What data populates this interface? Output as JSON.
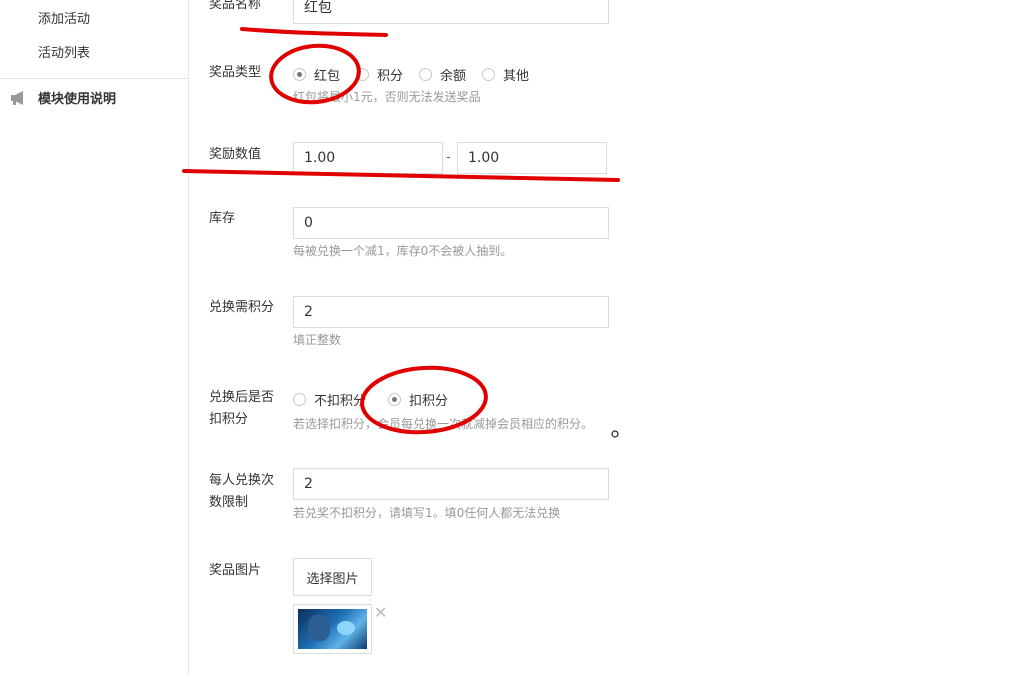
{
  "sidebar": {
    "items": [
      {
        "label": "添加活动"
      },
      {
        "label": "活动列表"
      }
    ],
    "section": {
      "label": "模块使用说明",
      "icon": "megaphone-icon"
    }
  },
  "form": {
    "prize_name": {
      "label": "奖品名称",
      "value": "红包"
    },
    "prize_type": {
      "label": "奖品类型",
      "options": [
        "红包",
        "积分",
        "余额",
        "其他"
      ],
      "selected": "红包",
      "help": "红包将最小1元，否则无法发送奖品"
    },
    "reward_value": {
      "label": "奖励数值",
      "min": "1.00",
      "separator": "-",
      "max": "1.00"
    },
    "stock": {
      "label": "库存",
      "value": "0",
      "help": "每被兑换一个减1，库存0不会被人抽到。"
    },
    "points_required": {
      "label": "兑换需积分",
      "value": "2",
      "help": "填正整数"
    },
    "deduct_points": {
      "label_line1": "兑换后是否",
      "label_line2": "扣积分",
      "options": [
        "不扣积分",
        "扣积分"
      ],
      "selected": "扣积分",
      "help": "若选择扣积分，会员每兑换一次就减掉会员相应的积分。"
    },
    "exchange_limit": {
      "label_line1": "每人兑换次",
      "label_line2": "数限制",
      "value": "2",
      "help": "若兑奖不扣积分，请填写1。填0任何人都无法兑换"
    },
    "prize_image": {
      "label": "奖品图片",
      "button": "选择图片",
      "remove": "✕"
    }
  },
  "colors": {
    "annotation": "#e00000",
    "border": "#dcdcdc",
    "help_text": "#999999"
  }
}
